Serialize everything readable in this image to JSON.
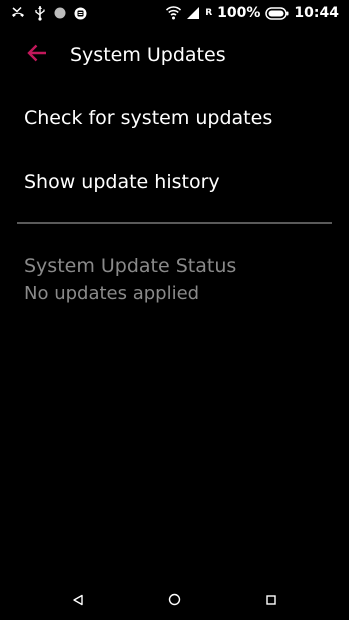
{
  "status_bar": {
    "left_icons": [
      "missed-call-icon",
      "usb-icon",
      "dot-icon",
      "messenger-icon"
    ],
    "right_icons": [
      "wifi-icon",
      "signal-icon",
      "battery-icon"
    ],
    "roaming": "R",
    "battery_percent": "100%",
    "time": "10:44"
  },
  "toolbar": {
    "title": "System Updates",
    "back_icon": "arrow-back-icon",
    "accent_color": "#c2185b"
  },
  "menu": {
    "items": [
      {
        "label": "Check for system updates"
      },
      {
        "label": "Show update history"
      }
    ]
  },
  "update_status": {
    "title": "System Update Status",
    "summary": "No updates applied"
  },
  "nav_bar": {
    "buttons": [
      "back-triangle-icon",
      "home-circle-icon",
      "recents-square-icon"
    ]
  }
}
